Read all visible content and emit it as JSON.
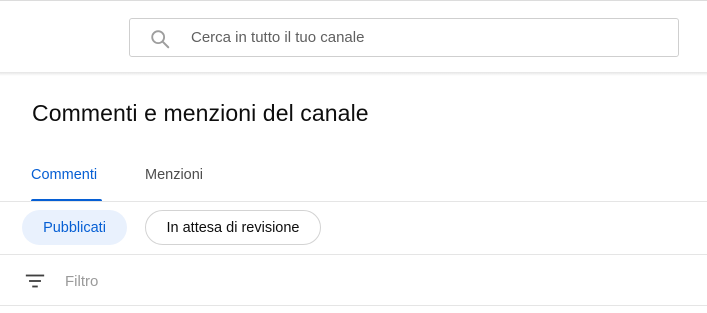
{
  "search": {
    "placeholder": "Cerca in tutto il tuo canale",
    "icon": "search-icon"
  },
  "page": {
    "title": "Commenti e menzioni del canale"
  },
  "tabs": [
    {
      "label": "Commenti",
      "active": true
    },
    {
      "label": "Menzioni",
      "active": false
    }
  ],
  "chips": [
    {
      "label": "Pubblicati",
      "selected": true
    },
    {
      "label": "In attesa di revisione",
      "selected": false
    }
  ],
  "filter": {
    "placeholder": "Filtro",
    "icon": "filter-icon"
  },
  "colors": {
    "accent": "#065fd4",
    "chip_selected_bg": "#e9f1fd"
  }
}
